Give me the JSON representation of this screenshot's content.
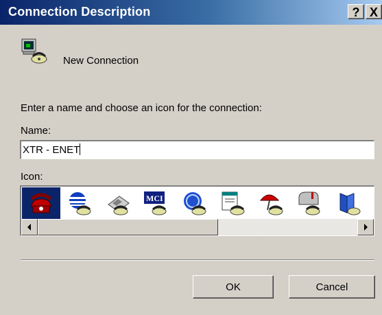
{
  "window": {
    "title": "Connection Description",
    "help_label": "?",
    "close_label": "X",
    "titlebar_colors": [
      "#0a246a",
      "#a6caf0"
    ]
  },
  "connection": {
    "display_name": "New Connection",
    "icon": "modem-computer-phone-icon"
  },
  "form": {
    "prompt": "Enter a name and choose an icon for the connection:",
    "name_label": "Name:",
    "name_value": "XTR - ENET",
    "icon_label": "Icon:",
    "icons": [
      {
        "name": "red-telephone-icon",
        "selected": true
      },
      {
        "name": "att-globe-icon",
        "selected": false
      },
      {
        "name": "fax-phone-icon",
        "selected": false
      },
      {
        "name": "mci-icon",
        "selected": false
      },
      {
        "name": "ge-globe-icon",
        "selected": false
      },
      {
        "name": "document-phone-icon",
        "selected": false
      },
      {
        "name": "umbrella-phone-icon",
        "selected": false
      },
      {
        "name": "mailbox-phone-icon",
        "selected": false
      },
      {
        "name": "book-phone-icon",
        "selected": false
      }
    ],
    "scrollbar_position": 0
  },
  "buttons": {
    "ok": "OK",
    "cancel": "Cancel"
  }
}
